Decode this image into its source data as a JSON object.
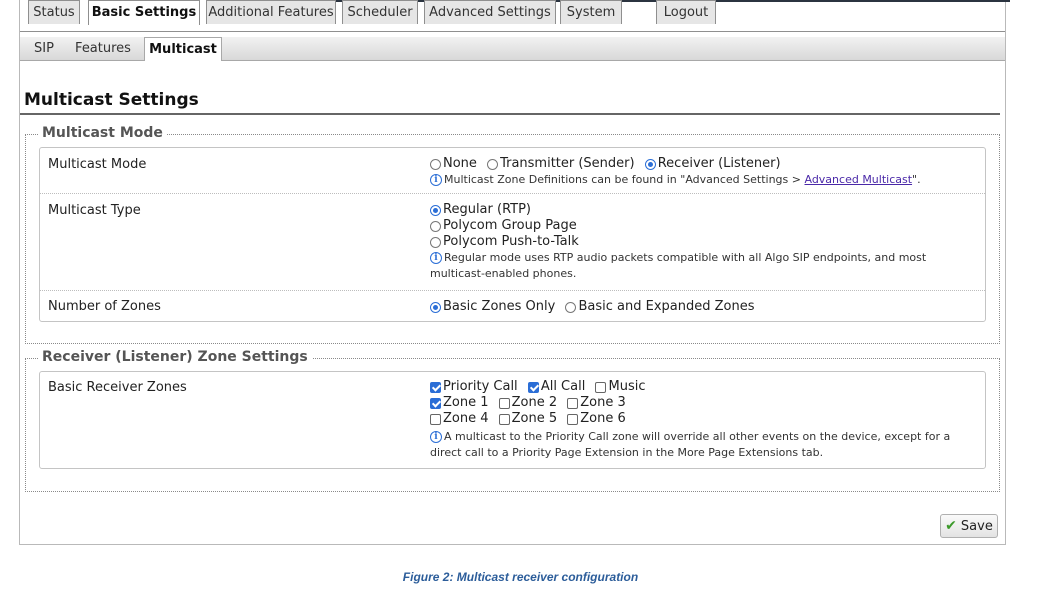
{
  "main_tabs": [
    "Status",
    "Basic Settings",
    "Additional Features",
    "Scheduler",
    "Advanced Settings",
    "System",
    "Logout"
  ],
  "main_tab_active": "Basic Settings",
  "sub_tabs": [
    "SIP",
    "Features",
    "Multicast"
  ],
  "sub_tab_active": "Multicast",
  "page_title": "Multicast Settings",
  "mode_section": {
    "legend": "Multicast Mode",
    "mode": {
      "label": "Multicast Mode",
      "options": [
        "None",
        "Transmitter (Sender)",
        "Receiver (Listener)"
      ],
      "selected": "Receiver (Listener)",
      "note_prefix": "Multicast Zone Definitions can be found in \"Advanced Settings > ",
      "note_link": "Advanced Multicast",
      "note_suffix": "\"."
    },
    "type": {
      "label": "Multicast Type",
      "options": [
        "Regular (RTP)",
        "Polycom Group Page",
        "Polycom Push-to-Talk"
      ],
      "selected": "Regular (RTP)",
      "note_line1": "Regular mode uses RTP audio packets compatible with all Algo SIP endpoints, and most",
      "note_line2": "multicast-enabled phones."
    },
    "zones": {
      "label": "Number of Zones",
      "options": [
        "Basic Zones Only",
        "Basic and Expanded Zones"
      ],
      "selected": "Basic Zones Only"
    }
  },
  "receiver_section": {
    "legend": "Receiver (Listener) Zone Settings",
    "label": "Basic Receiver Zones",
    "checkboxes": [
      {
        "label": "Priority Call",
        "checked": true
      },
      {
        "label": "All Call",
        "checked": true
      },
      {
        "label": "Music",
        "checked": false
      },
      {
        "label": "Zone 1",
        "checked": true
      },
      {
        "label": "Zone 2",
        "checked": false
      },
      {
        "label": "Zone 3",
        "checked": false
      },
      {
        "label": "Zone 4",
        "checked": false
      },
      {
        "label": "Zone 5",
        "checked": false
      },
      {
        "label": "Zone 6",
        "checked": false
      }
    ],
    "note_line1": "A multicast to the Priority Call zone will override all other events on the device, except for a",
    "note_line2": "direct call to a Priority Page Extension in the More Page Extensions tab."
  },
  "save_label": "Save",
  "caption": "Figure 2: Multicast receiver configuration",
  "colors": {
    "accent": "#2b6ed6",
    "link": "#4a28a8",
    "caption": "#2c5d9a",
    "save_check": "#3c9a2a"
  }
}
